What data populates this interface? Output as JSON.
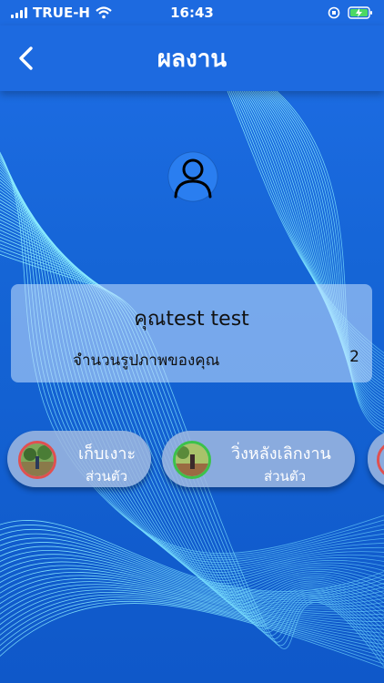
{
  "status_bar": {
    "carrier": "TRUE-H",
    "time": "16:43"
  },
  "nav": {
    "title": "ผลงาน",
    "back_icon": "chevron-left-icon"
  },
  "profile": {
    "avatar_icon": "user-icon",
    "name": "คุณtest test",
    "photo_count_label": "จำนวนรูปภาพของคุณ",
    "photo_count": "2"
  },
  "works": [
    {
      "title": "เก็บเงาะ",
      "type": "ส่วนตัว",
      "ring_color": "#e05050"
    },
    {
      "title": "วิ่งหลังเลิกงาน",
      "type": "ส่วนตัว",
      "ring_color": "#3cc24a"
    }
  ],
  "colors": {
    "nav_background": "#1d6ae0",
    "accent_wave": "#7fe7ff",
    "card_background": "#c8e1ff"
  }
}
